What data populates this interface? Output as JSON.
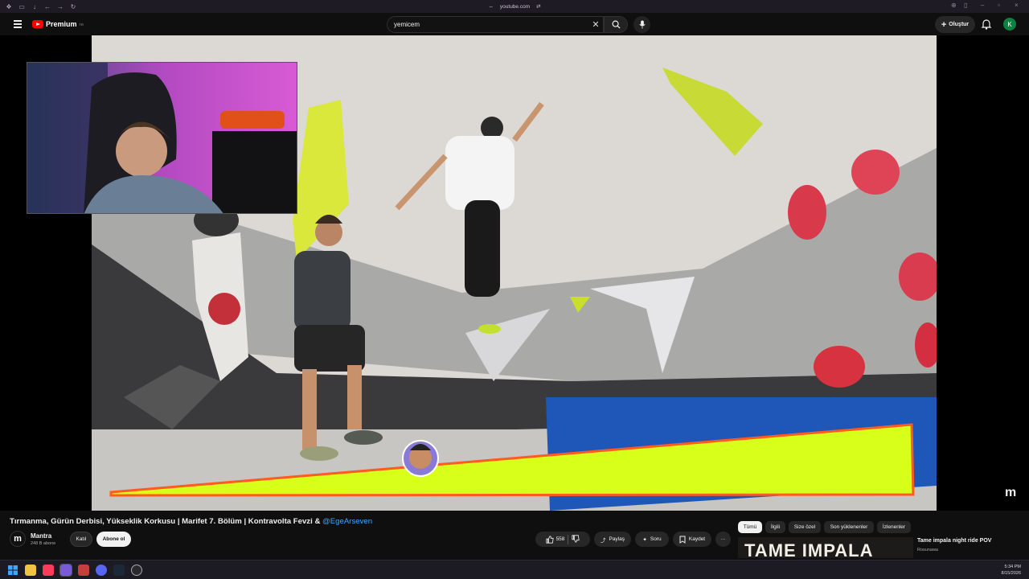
{
  "browser": {
    "url": "youtube.com"
  },
  "header": {
    "logo_text": "Premium",
    "logo_sup": "TR",
    "search_value": "yemicem",
    "create_label": "Oluştur",
    "account_initial": "K"
  },
  "player": {
    "watermark": "m"
  },
  "video": {
    "title": "Tırmanma, Gürün Derbisi, Yükseklik Korkusu | Marifet 7. Bölüm | Kontravolta Fevzi & ",
    "title_mention": "@EgeArseven"
  },
  "channel": {
    "avatar_letter": "m",
    "name": "Mantra",
    "subscribers": "248 B abone",
    "join_label": "Katıl",
    "subscribe_label": "Abone ol"
  },
  "actions": {
    "like_count": "558",
    "share_label": "Paylaş",
    "ask_label": "Soru",
    "save_label": "Kaydet",
    "more_label": "···"
  },
  "chips": [
    "Tümü",
    "İlgili",
    "Size özel",
    "Son yüklenenler",
    "İzlenenler"
  ],
  "recommendation": {
    "thumb_text": "TAME IMPALA",
    "title": "Tame impala night ride POV",
    "channel": "Rosunawa"
  },
  "taskbar": {
    "time": "5:34 PM",
    "date": "8/15/2026"
  },
  "colors": {
    "accent": "#ff0000",
    "link": "#3ea6ff",
    "banner_fill": "#d8ff1a",
    "banner_stroke": "#ff5a1f"
  }
}
